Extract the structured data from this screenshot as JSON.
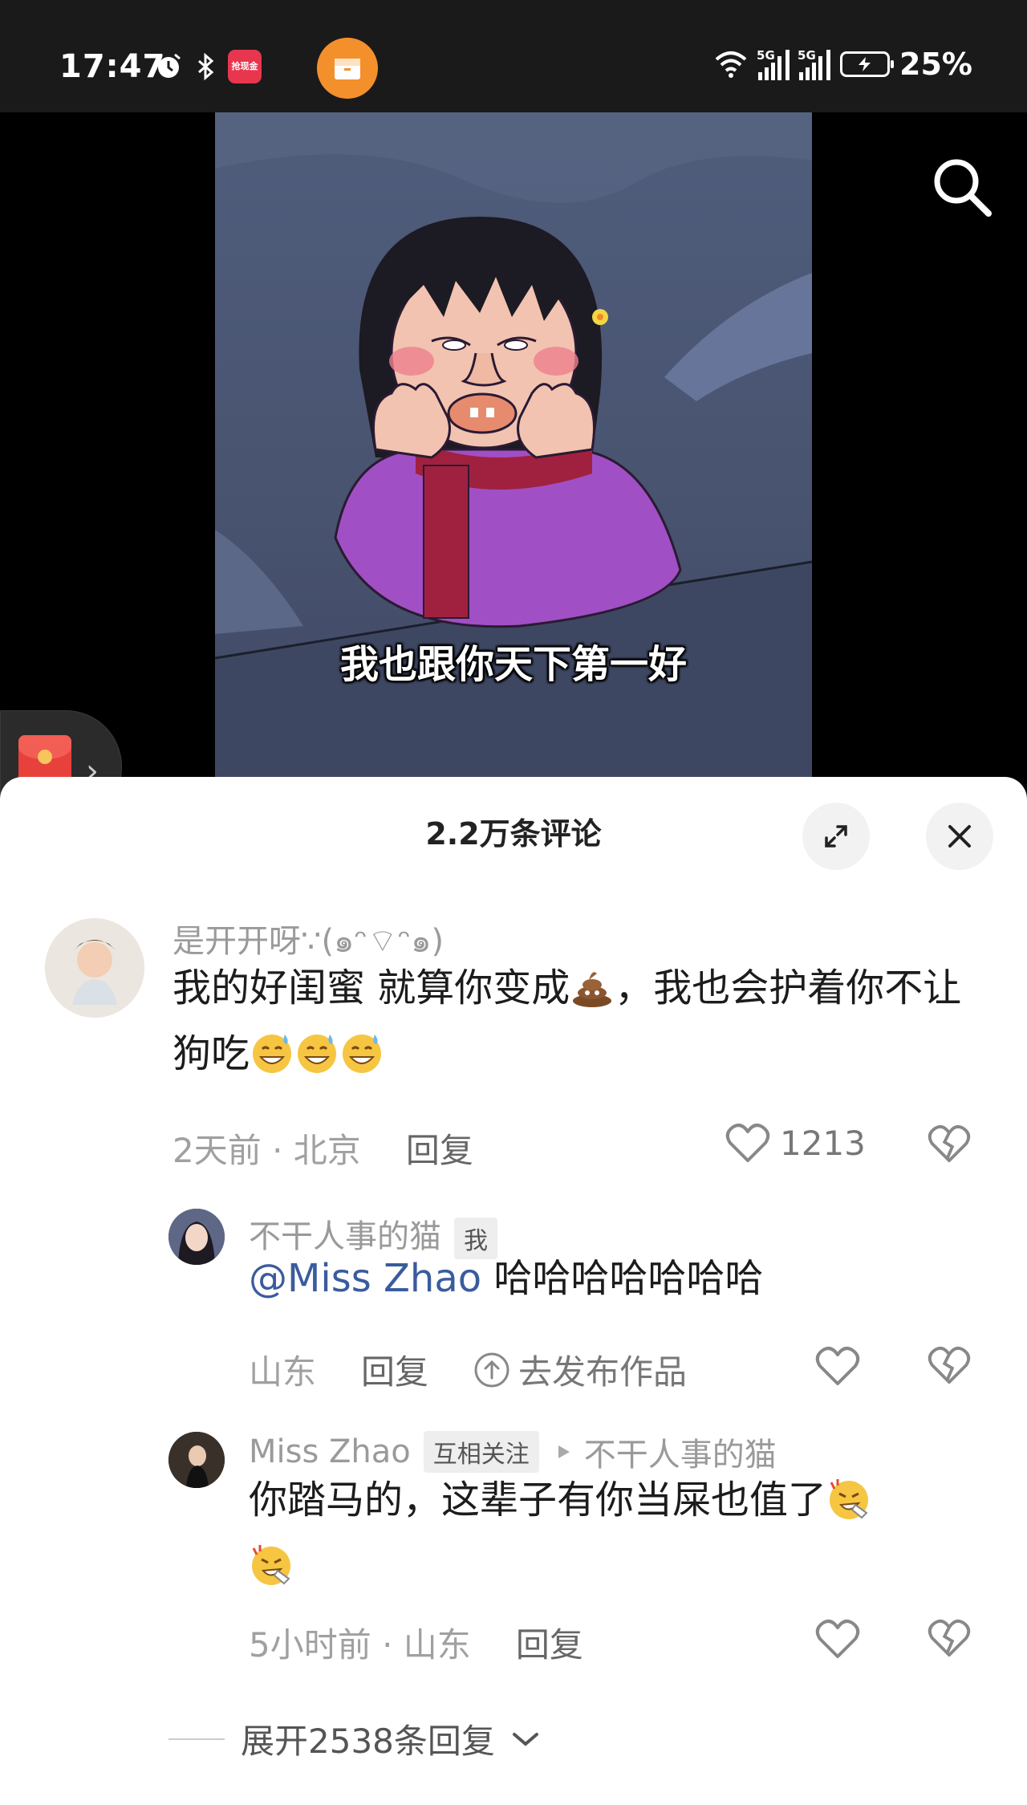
{
  "status_bar": {
    "time": "17:47",
    "app_badge_text": "抢现金",
    "battery_percent": "25%",
    "network_labels": [
      "5G",
      "5G"
    ]
  },
  "video": {
    "caption": "我也跟你天下第一好"
  },
  "comments_sheet": {
    "title": "2.2万条评论",
    "comments": [
      {
        "user": "是开开呀∵(๑ᵔ⌔ᵔ๑)",
        "text_part1": "我的好闺蜜 就算你变成",
        "text_part2": "，我也会护着你不让狗吃",
        "time": "2天前",
        "location": "北京",
        "reply_label": "回复",
        "likes": "1213"
      },
      {
        "user": "不干人事的猫",
        "tag": "我",
        "mention": "@Miss Zhao",
        "text": " 哈哈哈哈哈哈哈",
        "location": "山东",
        "reply_label": "回复",
        "publish_label": "去发布作品"
      },
      {
        "user": "Miss Zhao",
        "tag": "互相关注",
        "reply_to": "不干人事的猫",
        "text": "你踏马的，这辈子有你当屎也值了",
        "time": "5小时前",
        "location": "山东",
        "reply_label": "回复"
      }
    ],
    "expand_replies": "展开2538条回复"
  },
  "colors": {
    "accent_orange": "#f4902c",
    "mention_blue": "#3a5c9e",
    "video_bg": "#4f5d7c",
    "redpacket_red": "#e8413c"
  },
  "icons": [
    "alarm-icon",
    "bluetooth-icon",
    "wifi-icon",
    "signal-icon",
    "battery-icon",
    "search-icon",
    "expand-icon",
    "close-icon",
    "heart-icon",
    "broken-heart-icon",
    "chevron-down-icon",
    "upload-icon",
    "play-triangle-icon"
  ]
}
